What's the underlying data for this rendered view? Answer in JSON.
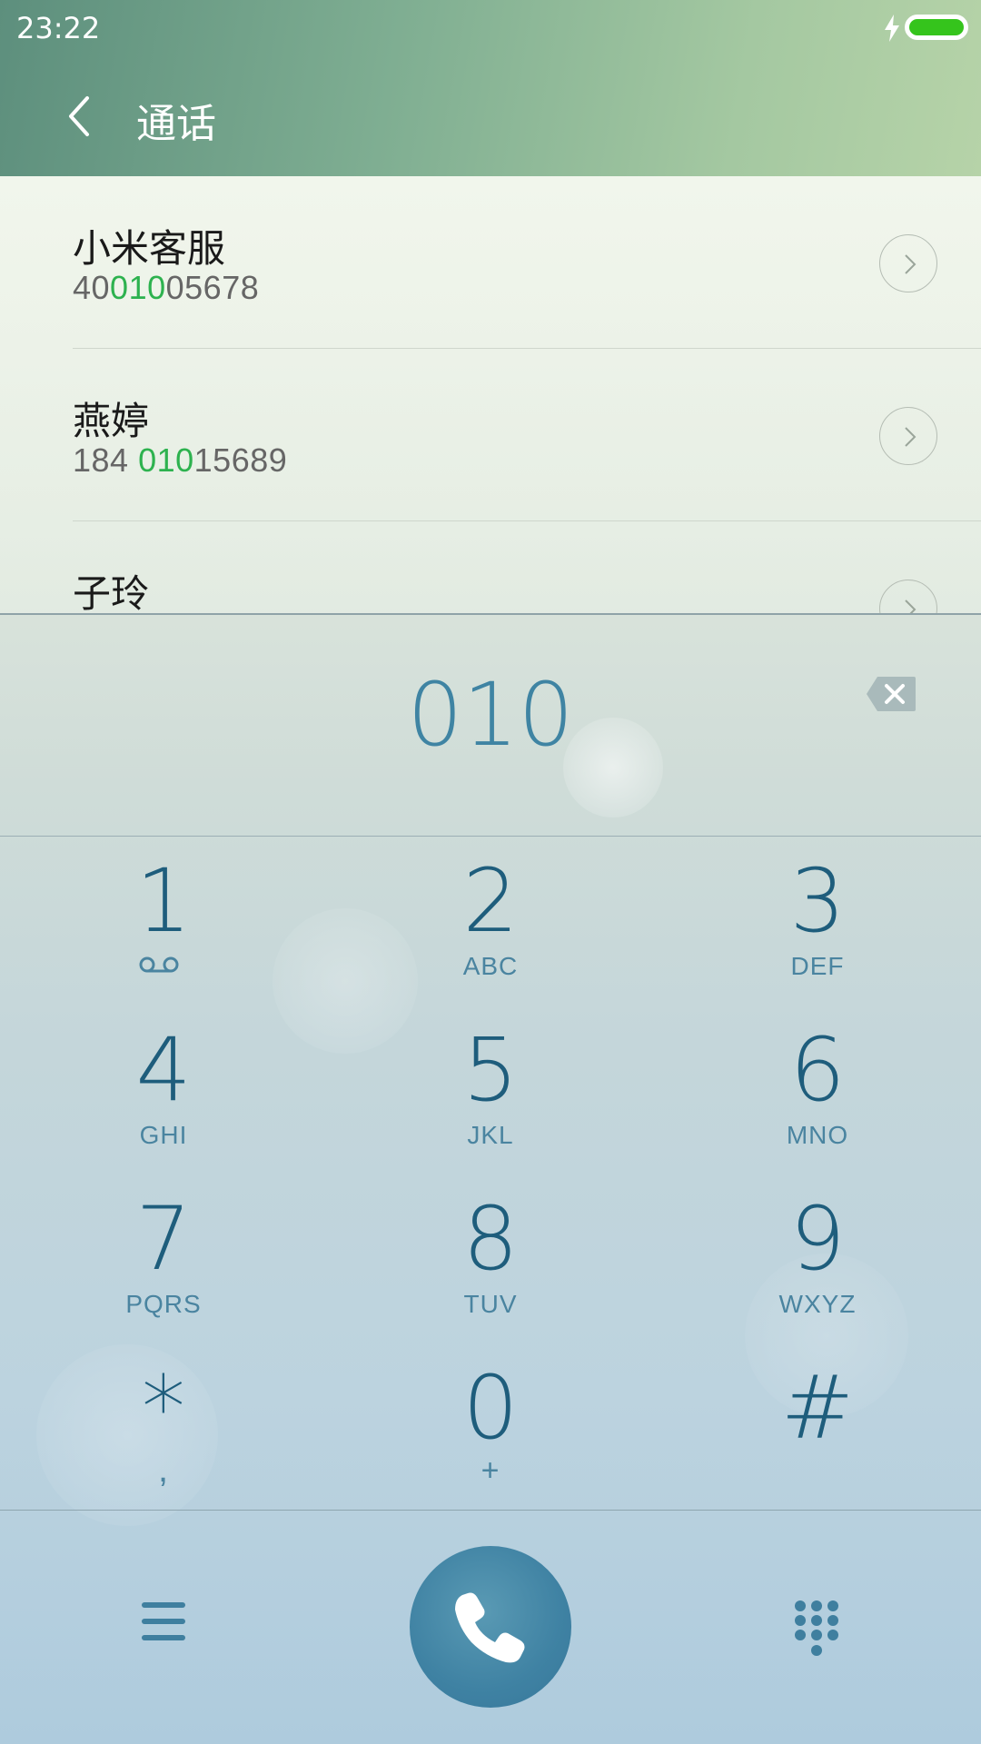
{
  "status_bar": {
    "time": "23:22",
    "battery_color": "#35c41c"
  },
  "header": {
    "title": "通话",
    "back_icon": "chevron-left-icon"
  },
  "contacts": [
    {
      "name": "小米客服",
      "number_prefix": "40",
      "number_match": "010",
      "number_suffix": "05678"
    },
    {
      "name": "燕婷",
      "number_prefix": "184 ",
      "number_match": "010",
      "number_suffix": "15689"
    },
    {
      "name": "子玲",
      "number_prefix": "",
      "number_match": "",
      "number_suffix": ""
    }
  ],
  "dialer": {
    "dialed_number": "010",
    "delete_icon": "backspace-icon",
    "match_color": "#2db24f"
  },
  "keypad": [
    {
      "digit": "1",
      "letters": "",
      "sub_icon": "voicemail-icon"
    },
    {
      "digit": "2",
      "letters": "ABC"
    },
    {
      "digit": "3",
      "letters": "DEF"
    },
    {
      "digit": "4",
      "letters": "GHI"
    },
    {
      "digit": "5",
      "letters": "JKL"
    },
    {
      "digit": "6",
      "letters": "MNO"
    },
    {
      "digit": "7",
      "letters": "PQRS"
    },
    {
      "digit": "8",
      "letters": "TUV"
    },
    {
      "digit": "9",
      "letters": "WXYZ"
    },
    {
      "digit": "*",
      "letters": ","
    },
    {
      "digit": "0",
      "letters": "+"
    },
    {
      "digit": "#",
      "letters": ""
    }
  ],
  "actions": {
    "menu_icon": "menu-icon",
    "call_icon": "phone-icon",
    "dialpad_icon": "dialpad-icon",
    "call_color": "#3f82a3"
  }
}
